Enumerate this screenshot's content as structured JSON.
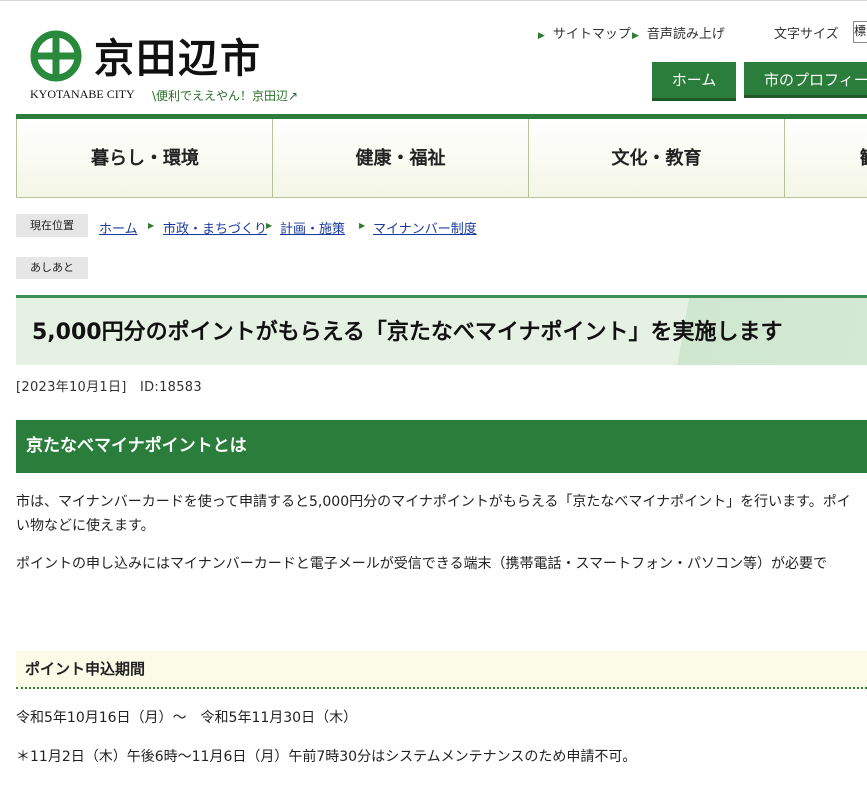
{
  "header": {
    "city_name": "京田辺市",
    "city_name_en": "KYOTANABE CITY",
    "slogan": "\\便利でええやん！京田辺↗",
    "utility": {
      "sitemap": "サイトマップ",
      "read_aloud": "音声読み上げ",
      "font_size_label": "文字サイズ",
      "font_size_value": "標"
    },
    "buttons": {
      "home": "ホーム",
      "profile": "市のプロフィール"
    }
  },
  "global_nav": [
    "暮らし・環境",
    "健康・福祉",
    "文化・教育",
    "観"
  ],
  "breadcrumb": {
    "label": "現在位置",
    "items": [
      "ホーム",
      "市政・まちづくり",
      "計画・施策",
      "マイナンバー制度"
    ]
  },
  "footprint_label": "あしあと",
  "article": {
    "title": "5,000円分のポイントがもらえる「京たなべマイナポイント」を実施します",
    "date_id": "[2023年10月1日]　ID:18583",
    "section1_heading": "京たなべマイナポイントとは",
    "para1_line1": "市は、マイナンバーカードを使って申請すると5,000円分のマイナポイントがもらえる「京たなべマイナポイント」を行います。ポイ",
    "para1_line2": "い物などに使えます。",
    "para2": "ポイントの申し込みにはマイナンバーカードと電子メールが受信できる端末（携帯電話・スマートフォン・パソコン等）が必要で",
    "section2_heading": "ポイント申込期間",
    "period": "令和5年10月16日（月）～　令和5年11月30日（木）",
    "note": "＊11月2日（木）午後6時～11月6日（月）午前7時30分はシステムメンテナンスのため申請不可。"
  }
}
